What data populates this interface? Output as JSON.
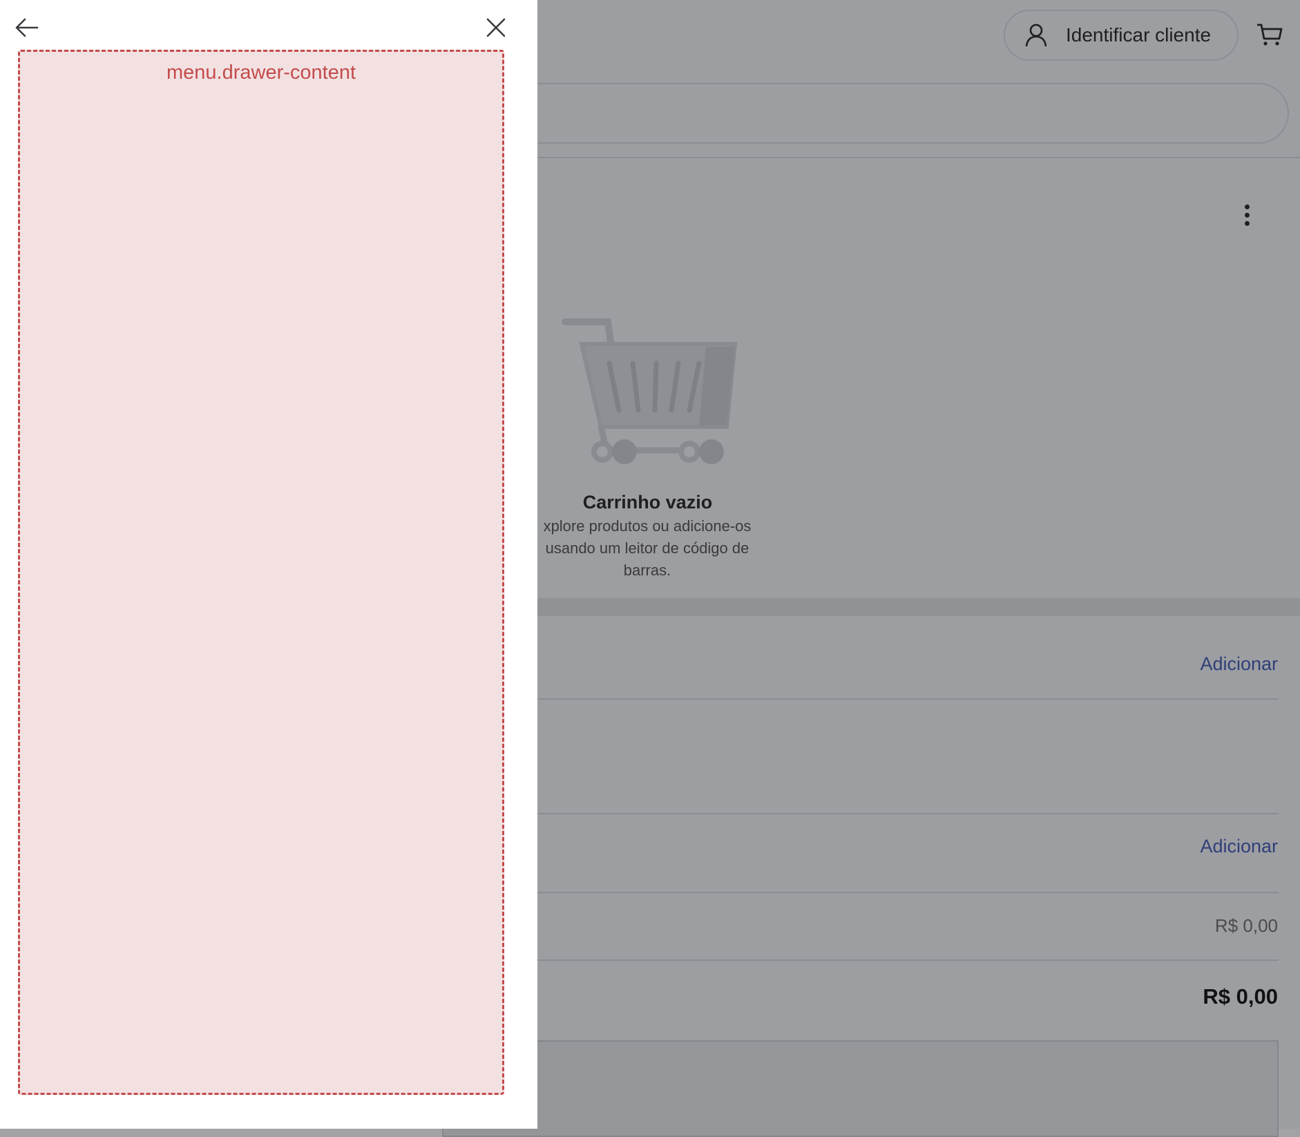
{
  "header": {
    "identify_label": "Identificar cliente",
    "identify_icon": "user-icon",
    "cart_icon": "cart-icon"
  },
  "cart": {
    "more_icon": "more-vertical-icon",
    "empty_title": "Carrinho vazio",
    "empty_description": "xplore produtos ou adicione-os usando um leitor de código de barras."
  },
  "summary": {
    "add_label_1": "Adicionar",
    "add_label_2": "Adicionar",
    "subtotal_value": "R$ 0,00",
    "total_value": "R$ 0,00"
  },
  "drawer": {
    "back_icon": "arrow-left-icon",
    "close_icon": "close-icon",
    "content_label": "menu.drawer-content"
  },
  "colors": {
    "overlay": "#9d9ea2",
    "link": "#2f3f78",
    "debug_border": "#c44b4b",
    "debug_fill": "#f3e1e2"
  }
}
